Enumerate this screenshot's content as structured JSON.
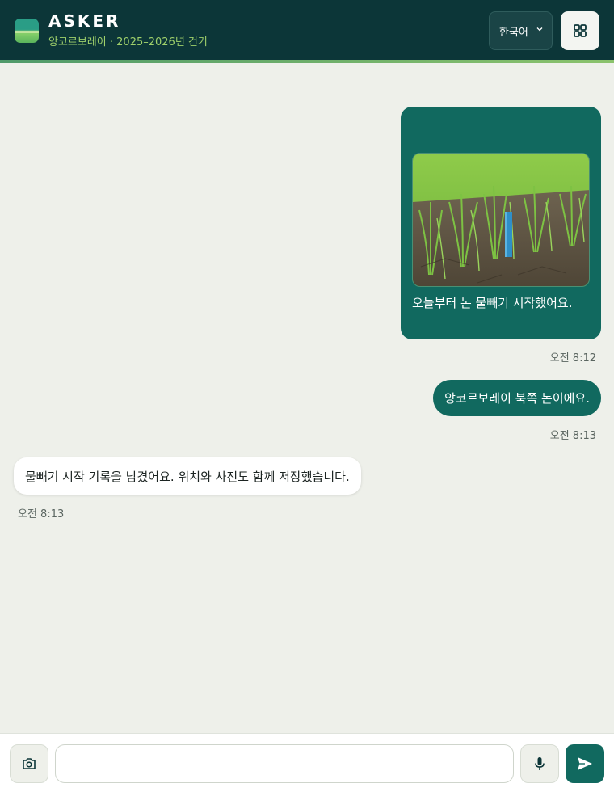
{
  "header": {
    "brand": "ASKER",
    "subtitle": "앙코르보레이 · 2025–2026년 건기",
    "language": "한국어",
    "icons": {
      "logo": "field-logo",
      "chevron": "chevron-down-icon",
      "menu": "grid-icon"
    }
  },
  "messages": [
    {
      "from": "user",
      "kind": "photo",
      "photo": "rice-paddy-with-water-gauge",
      "text": "오늘부터 논 물빼기 시작했어요.",
      "time": "오전 8:12"
    },
    {
      "from": "user",
      "kind": "text",
      "text": "앙코르보레이 북쪽 논이에요.",
      "time": "오전 8:13"
    },
    {
      "from": "bot",
      "kind": "text",
      "text": "물빼기 시작 기록을 남겼어요. 위치와 사진도 함께 저장했습니다.",
      "time": "오전 8:13"
    }
  ],
  "composer": {
    "value": "",
    "icons": {
      "camera": "camera-icon",
      "mic": "microphone-icon",
      "send": "send-icon"
    }
  },
  "colors": {
    "header_bg": "#0c3638",
    "accent": "#11695f",
    "subtitle": "#9fd06b",
    "background": "#eef0ea"
  }
}
